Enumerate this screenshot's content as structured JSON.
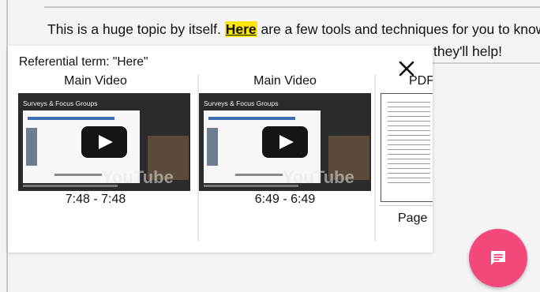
{
  "document": {
    "line1_before": "This is a huge topic by itself. ",
    "line1_highlight": "Here",
    "line1_after": " are a few tools and techniques for you to know",
    "line2_end": "they'll help!"
  },
  "popup": {
    "title": "Referential term: \"Here\"",
    "cards": [
      {
        "title": "Main Video",
        "thumb_banner": "Surveys & Focus Groups",
        "thumb_watermark": "YouTube",
        "time": "7:48 - 7:48"
      },
      {
        "title": "Main Video",
        "thumb_banner": "Surveys & Focus Groups",
        "thumb_watermark": "YouTube",
        "time": "6:49 - 6:49"
      }
    ],
    "pdf_card": {
      "title": "PDF",
      "footer": "Page"
    }
  },
  "icons": {
    "close": "close-icon",
    "play": "play-icon",
    "chat": "chat-icon"
  },
  "colors": {
    "highlight": "#ffe600",
    "fab": "#f2487a"
  }
}
